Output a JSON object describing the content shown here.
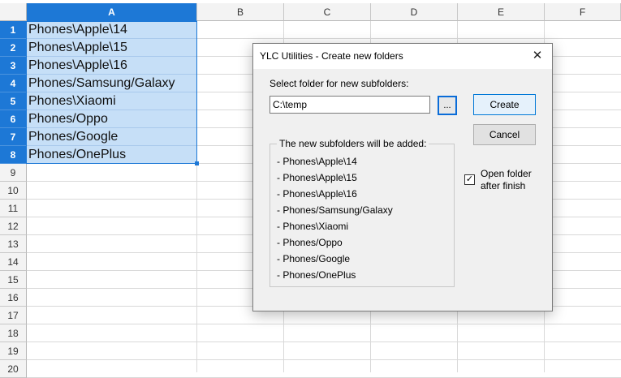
{
  "spreadsheet": {
    "columns": [
      "A",
      "B",
      "C",
      "D",
      "E",
      "F"
    ],
    "selected_column": "A",
    "rows": [
      "1",
      "2",
      "3",
      "4",
      "5",
      "6",
      "7",
      "8",
      "9",
      "10",
      "11",
      "12",
      "13",
      "14",
      "15",
      "16",
      "17",
      "18",
      "19",
      "20"
    ],
    "selected_rows": [
      "1",
      "2",
      "3",
      "4",
      "5",
      "6",
      "7",
      "8"
    ],
    "cells_a": [
      "Phones\\Apple\\14",
      "Phones\\Apple\\15",
      "Phones\\Apple\\16",
      "Phones/Samsung/Galaxy",
      "Phones\\Xiaomi",
      "Phones/Oppo",
      "Phones/Google",
      "Phones/OnePlus"
    ],
    "selection_color": "#c6dff7",
    "header_selected_color": "#1d78d6"
  },
  "dialog": {
    "title": "YLC Utilities - Create new folders",
    "close_icon": "✕",
    "folder_label": "Select folder for new subfolders:",
    "folder_value": "C:\\temp",
    "browse_label": "...",
    "create_label": "Create",
    "cancel_label": "Cancel",
    "group_title": "The new subfolders will be added:",
    "subfolders": [
      "- Phones\\Apple\\14",
      "- Phones\\Apple\\15",
      "- Phones\\Apple\\16",
      "- Phones/Samsung/Galaxy",
      "- Phones\\Xiaomi",
      "- Phones/Oppo",
      "- Phones/Google",
      "- Phones/OnePlus"
    ],
    "open_folder_label": "Open folder after finish",
    "open_folder_checked": true,
    "check_icon": "✓"
  }
}
